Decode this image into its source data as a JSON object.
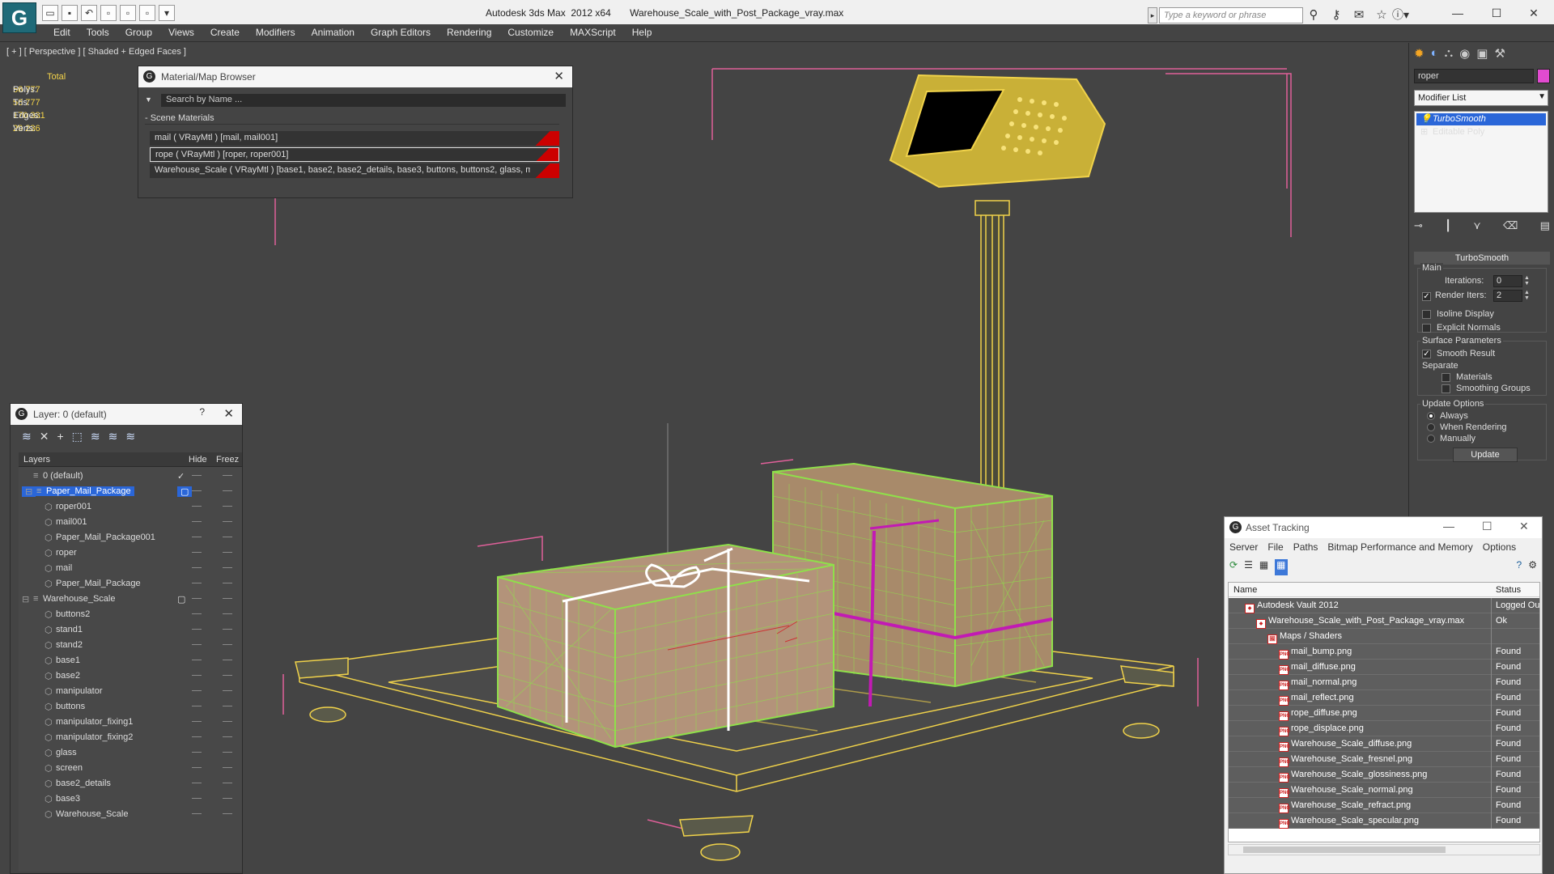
{
  "app": {
    "window_title": "Autodesk 3ds Max  2012 x64       Warehouse_Scale_with_Post_Package_vray.max",
    "search_placeholder": "Type a keyword or phrase"
  },
  "menu": [
    "Edit",
    "Tools",
    "Group",
    "Views",
    "Create",
    "Modifiers",
    "Animation",
    "Graph Editors",
    "Rendering",
    "Customize",
    "MAXScript",
    "Help"
  ],
  "viewport": {
    "label": "[ + ] [ Perspective ] [ Shaded + Edged Faces ]",
    "stats": {
      "header": "Total",
      "rows": [
        {
          "label": "Polys:",
          "value": "56 777"
        },
        {
          "label": "Tris:",
          "value": "56 777"
        },
        {
          "label": "Edges:",
          "value": "170 331"
        },
        {
          "label": "Verts:",
          "value": "29 236"
        }
      ]
    },
    "colors": {
      "wire_yellow": "#f0d24a",
      "wire_green": "#8fe04a",
      "bracket_pink": "#e0609a",
      "rope_magenta": "#c21ab4"
    }
  },
  "material_browser": {
    "title": "Material/Map Browser",
    "search_placeholder": "Search by Name ...",
    "section": "- Scene Materials",
    "rows": [
      "mail  ( VRayMtl ) [mail, mail001]",
      "rope  ( VRayMtl ) [roper, roper001]",
      "Warehouse_Scale  ( VRayMtl ) [base1, base2, base2_details, base3, buttons, buttons2, glass, m..."
    ]
  },
  "layer_panel": {
    "title": "Layer: 0 (default)",
    "help": "?",
    "columns": {
      "layers": "Layers",
      "hide": "Hide",
      "freeze": "Freez"
    },
    "rows": [
      {
        "name": "0 (default)",
        "level": 0
      },
      {
        "name": "Paper_Mail_Package",
        "level": 0
      },
      {
        "name": "roper001",
        "level": 1
      },
      {
        "name": "mail001",
        "level": 1
      },
      {
        "name": "Paper_Mail_Package001",
        "level": 1
      },
      {
        "name": "roper",
        "level": 1
      },
      {
        "name": "mail",
        "level": 1
      },
      {
        "name": "Paper_Mail_Package",
        "level": 1
      },
      {
        "name": "Warehouse_Scale",
        "level": 0
      },
      {
        "name": "buttons2",
        "level": 1
      },
      {
        "name": "stand1",
        "level": 1
      },
      {
        "name": "stand2",
        "level": 1
      },
      {
        "name": "base1",
        "level": 1
      },
      {
        "name": "base2",
        "level": 1
      },
      {
        "name": "manipulator",
        "level": 1
      },
      {
        "name": "buttons",
        "level": 1
      },
      {
        "name": "manipulator_fixing1",
        "level": 1
      },
      {
        "name": "manipulator_fixing2",
        "level": 1
      },
      {
        "name": "glass",
        "level": 1
      },
      {
        "name": "screen",
        "level": 1
      },
      {
        "name": "base2_details",
        "level": 1
      },
      {
        "name": "base3",
        "level": 1
      },
      {
        "name": "Warehouse_Scale",
        "level": 1
      }
    ]
  },
  "command_panel": {
    "object_name": "roper",
    "modifier_list": "Modifier List",
    "stack": [
      "TurboSmooth",
      "Editable Poly"
    ],
    "rollout": "TurboSmooth",
    "main": "Main",
    "iterations_label": "Iterations:",
    "iterations": "0",
    "render_iters_label": "Render Iters:",
    "render_iters": "2",
    "isoline": "Isoline Display",
    "explicit_normals": "Explicit Normals",
    "surface_params": "Surface Parameters",
    "smooth_result": "Smooth Result",
    "separate": "Separate",
    "materials": "Materials",
    "smoothing_groups": "Smoothing Groups",
    "update_options": "Update Options",
    "always": "Always",
    "when_rendering": "When Rendering",
    "manually": "Manually",
    "update_btn": "Update"
  },
  "asset_tracking": {
    "title": "Asset Tracking",
    "menu": [
      "Server",
      "File",
      "Paths",
      "Bitmap Performance and Memory",
      "Options"
    ],
    "columns": {
      "name": "Name",
      "status": "Status"
    },
    "rows": [
      {
        "name": "Autodesk Vault 2012",
        "status": "Logged Ou",
        "indent": 1
      },
      {
        "name": "Warehouse_Scale_with_Post_Package_vray.max",
        "status": "Ok",
        "indent": 2
      },
      {
        "name": "Maps / Shaders",
        "status": "",
        "indent": 3
      },
      {
        "name": "mail_bump.png",
        "status": "Found",
        "indent": 4
      },
      {
        "name": "mail_diffuse.png",
        "status": "Found",
        "indent": 4
      },
      {
        "name": "mail_normal.png",
        "status": "Found",
        "indent": 4
      },
      {
        "name": "mail_reflect.png",
        "status": "Found",
        "indent": 4
      },
      {
        "name": "rope_diffuse.png",
        "status": "Found",
        "indent": 4
      },
      {
        "name": "rope_displace.png",
        "status": "Found",
        "indent": 4
      },
      {
        "name": "Warehouse_Scale_diffuse.png",
        "status": "Found",
        "indent": 4
      },
      {
        "name": "Warehouse_Scale_fresnel.png",
        "status": "Found",
        "indent": 4
      },
      {
        "name": "Warehouse_Scale_glossiness.png",
        "status": "Found",
        "indent": 4
      },
      {
        "name": "Warehouse_Scale_normal.png",
        "status": "Found",
        "indent": 4
      },
      {
        "name": "Warehouse_Scale_refract.png",
        "status": "Found",
        "indent": 4
      },
      {
        "name": "Warehouse_Scale_specular.png",
        "status": "Found",
        "indent": 4
      }
    ]
  }
}
